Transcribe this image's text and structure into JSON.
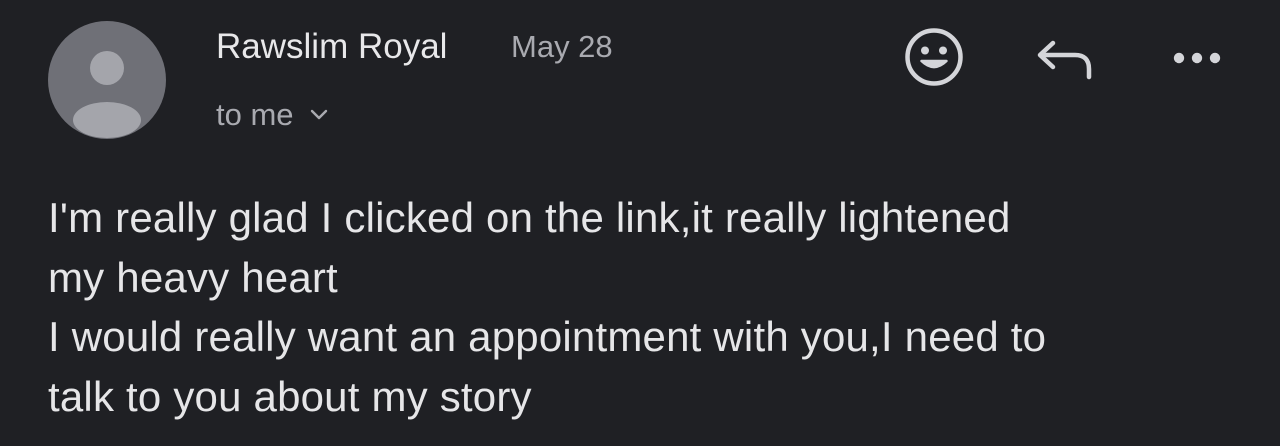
{
  "email": {
    "sender": "Rawslim Royal",
    "date": "May 28",
    "recipient": "to me",
    "avatar_icon": "person-icon",
    "body_lines": [
      "I'm really glad I clicked on the link,it really lightened",
      "my heavy heart",
      "I would really want an appointment with you,I need to",
      "talk to you about my story"
    ]
  },
  "actions": {
    "emoji_icon": "smiley-icon",
    "reply_icon": "reply-icon",
    "more_icon": "more-horizontal-icon"
  },
  "colors": {
    "background": "#1f2024",
    "primary_text": "#e6e6e8",
    "secondary_text": "#a9aab0",
    "avatar_bg": "#6f7077",
    "avatar_fg": "#a4a5ab"
  }
}
